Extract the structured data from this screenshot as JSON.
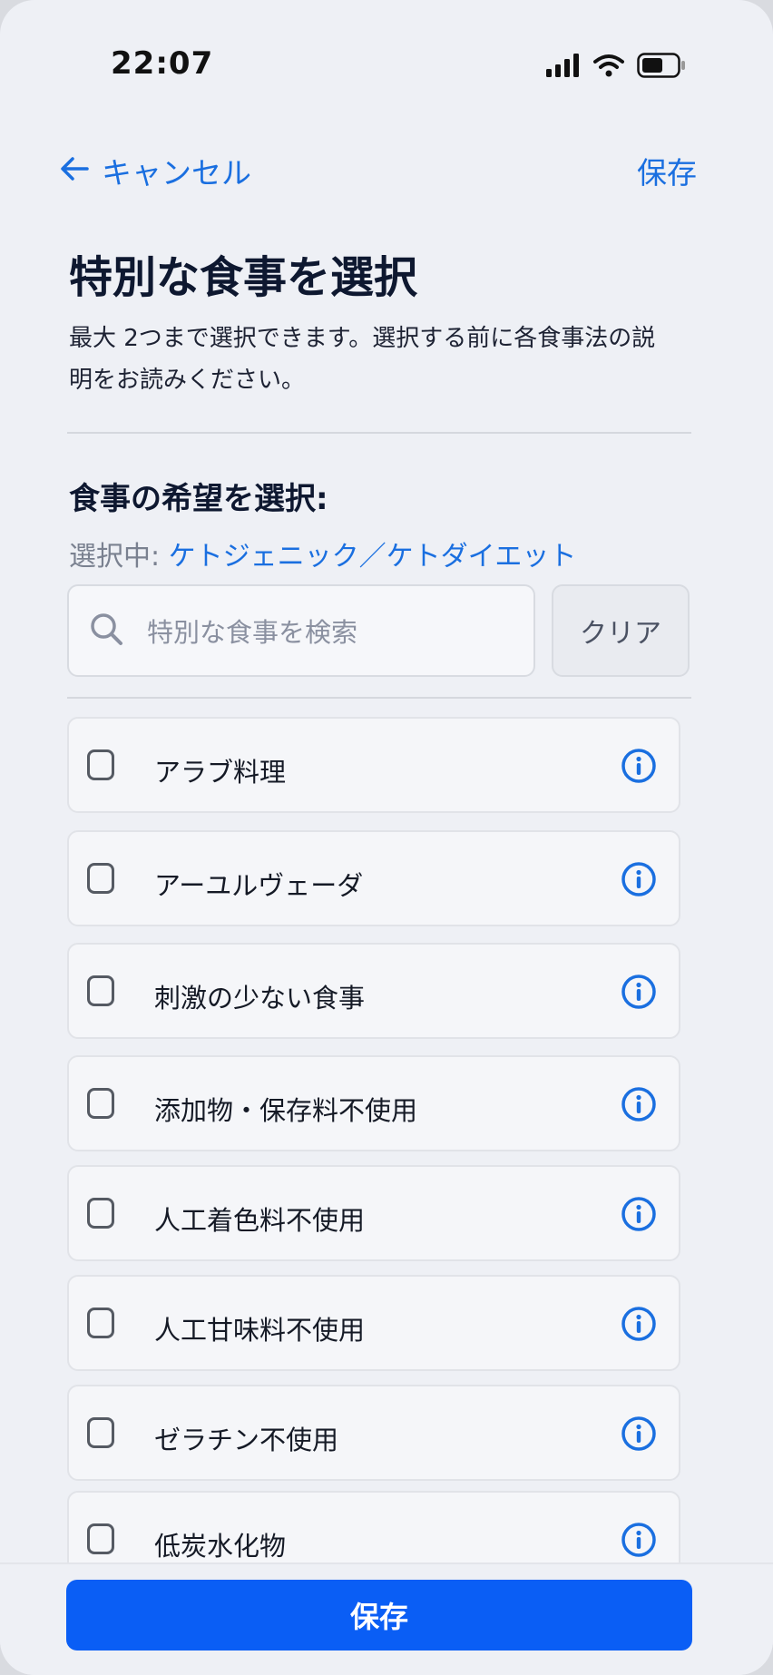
{
  "status_bar": {
    "time": "22:07",
    "icons": [
      "signal-icon",
      "wifi-icon",
      "battery-icon"
    ]
  },
  "nav": {
    "back_label": "キャンセル",
    "save_label": "保存"
  },
  "header": {
    "title": "特別な食事を選択",
    "description": "最大 2つまで選択できます。選択する前に各食事法の説明をお読みください。"
  },
  "section": {
    "title": "食事の希望を選択:",
    "selected_label": "選択中:",
    "selected_value": "ケトジェニック／ケトダイエット"
  },
  "search": {
    "placeholder": "特別な食事を検索",
    "value": "",
    "clear_label": "クリア"
  },
  "diets": [
    {
      "label": "アラブ料理",
      "checked": false
    },
    {
      "label": "アーユルヴェーダ",
      "checked": false
    },
    {
      "label": "刺激の少ない食事",
      "checked": false
    },
    {
      "label": "添加物・保存料不使用",
      "checked": false
    },
    {
      "label": "人工着色料不使用",
      "checked": false
    },
    {
      "label": "人工甘味料不使用",
      "checked": false
    },
    {
      "label": "ゼラチン不使用",
      "checked": false
    },
    {
      "label": "低炭水化物",
      "checked": false
    }
  ],
  "footer": {
    "save_label": "保存"
  },
  "colors": {
    "accent": "#1a6fe0",
    "primary_button": "#0a5ef5",
    "background": "#eef0f5"
  }
}
